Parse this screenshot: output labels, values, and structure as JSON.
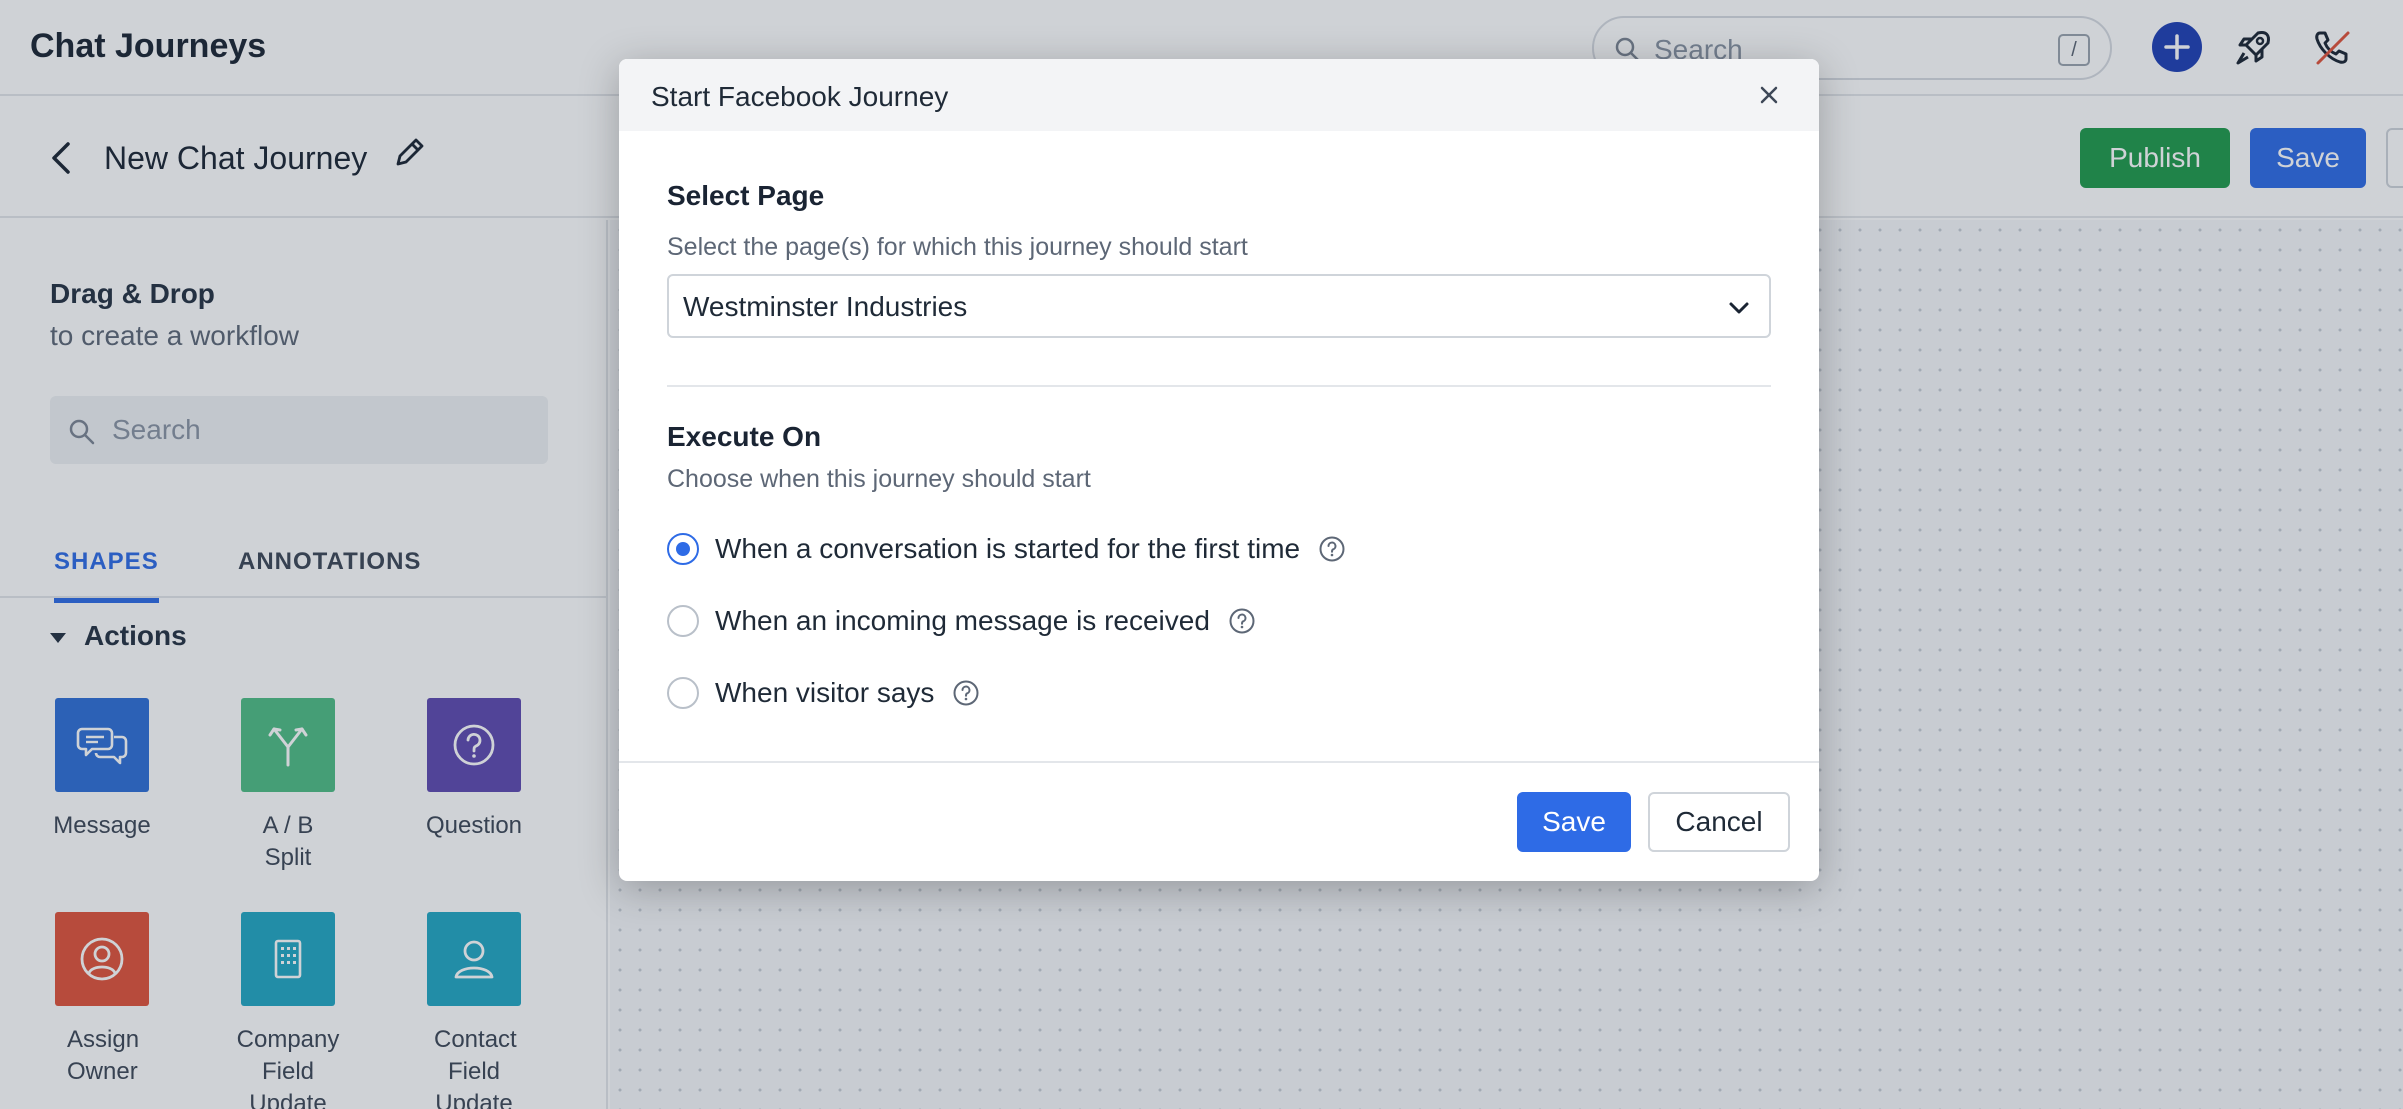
{
  "app": {
    "title": "Chat Journeys",
    "search_placeholder": "Search",
    "search_shortcut": "/"
  },
  "journey": {
    "name": "New Chat Journey",
    "publish_label": "Publish",
    "save_label": "Save"
  },
  "sidebar": {
    "title": "Drag & Drop",
    "subtitle": "to create a workflow",
    "search_placeholder": "Search",
    "tabs": [
      {
        "label": "SHAPES",
        "active": true
      },
      {
        "label": "ANNOTATIONS",
        "active": false
      }
    ],
    "section": "Actions",
    "tiles": [
      {
        "label": "Message",
        "icon": "message-icon",
        "color": "#2f6fd6"
      },
      {
        "label": "A / B Split",
        "icon": "split-icon",
        "color": "#4fbd85"
      },
      {
        "label": "Question",
        "icon": "question-icon",
        "color": "#5e49b0"
      },
      {
        "label": "Assign Owner",
        "icon": "user-circle-icon",
        "color": "#e0533a"
      },
      {
        "label": "Company Field Update",
        "icon": "building-icon",
        "color": "#22a7c3"
      },
      {
        "label": "Contact Field Update",
        "icon": "person-icon",
        "color": "#22a7c3"
      }
    ]
  },
  "modal": {
    "title": "Start Facebook Journey",
    "select_page": {
      "label": "Select Page",
      "help": "Select the page(s) for which this journey should start",
      "value": "Westminster Industries"
    },
    "execute_on": {
      "label": "Execute On",
      "help": "Choose when this journey should start",
      "options": [
        {
          "label": "When a conversation is started for the first time",
          "checked": true
        },
        {
          "label": "When an incoming message is received",
          "checked": false
        },
        {
          "label": "When visitor says",
          "checked": false
        }
      ]
    },
    "save_label": "Save",
    "cancel_label": "Cancel"
  },
  "colors": {
    "primary": "#2e6be6",
    "publish": "#1f9a4b"
  }
}
